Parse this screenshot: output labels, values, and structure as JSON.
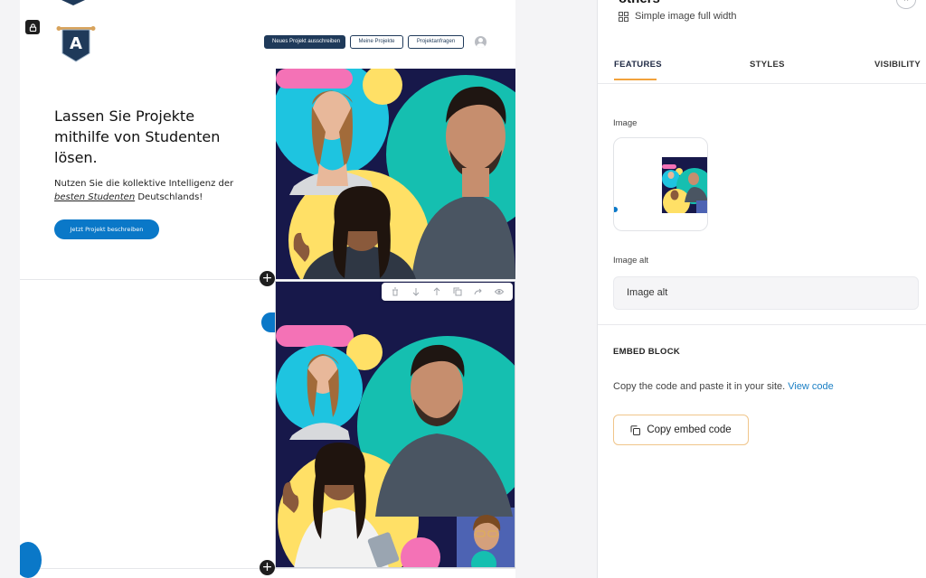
{
  "colors": {
    "brand_navy": "#1f3a5a",
    "brand_blue": "#0a78c8",
    "accent_orange": "#f2a23c",
    "link_blue": "#1a7fc4",
    "img_navy": "#17184a",
    "img_cyan": "#1ec4e0",
    "img_teal": "#15bfb0",
    "img_yellow": "#ffe066",
    "img_pink": "#f472b6"
  },
  "canvas": {
    "logo_letter": "A",
    "nav": {
      "primary": "Neues Projekt ausschreiben",
      "my_projects": "Meine Projekte",
      "requests": "Projektanfragen"
    },
    "hero": {
      "title": "Lassen Sie Projekte mithilfe von Studenten lösen.",
      "sub_prefix": "Nutzen Sie die kollektive Intelligenz der ",
      "sub_emph": "besten Studenten",
      "sub_suffix": " Deutschlands!",
      "cta": "Jetzt Projekt beschreiben"
    },
    "plus_glyph": "+",
    "toolbar_icons": [
      "trash-icon",
      "arrow-down-icon",
      "arrow-up-icon",
      "copy-icon",
      "redo-icon",
      "eye-icon"
    ]
  },
  "panel": {
    "title": "others",
    "close_glyph": "×",
    "subtitle": "Simple image full width",
    "tabs": [
      "FEATURES",
      "STYLES",
      "VISIBILITY"
    ],
    "active_tab": "FEATURES",
    "image_label": "Image",
    "image_alt_label": "Image alt",
    "image_alt_value": "Image alt",
    "embed_heading": "EMBED BLOCK",
    "embed_text": "Copy the code and paste it in your site.",
    "embed_link": "View code",
    "copy_button": "Copy embed code"
  }
}
